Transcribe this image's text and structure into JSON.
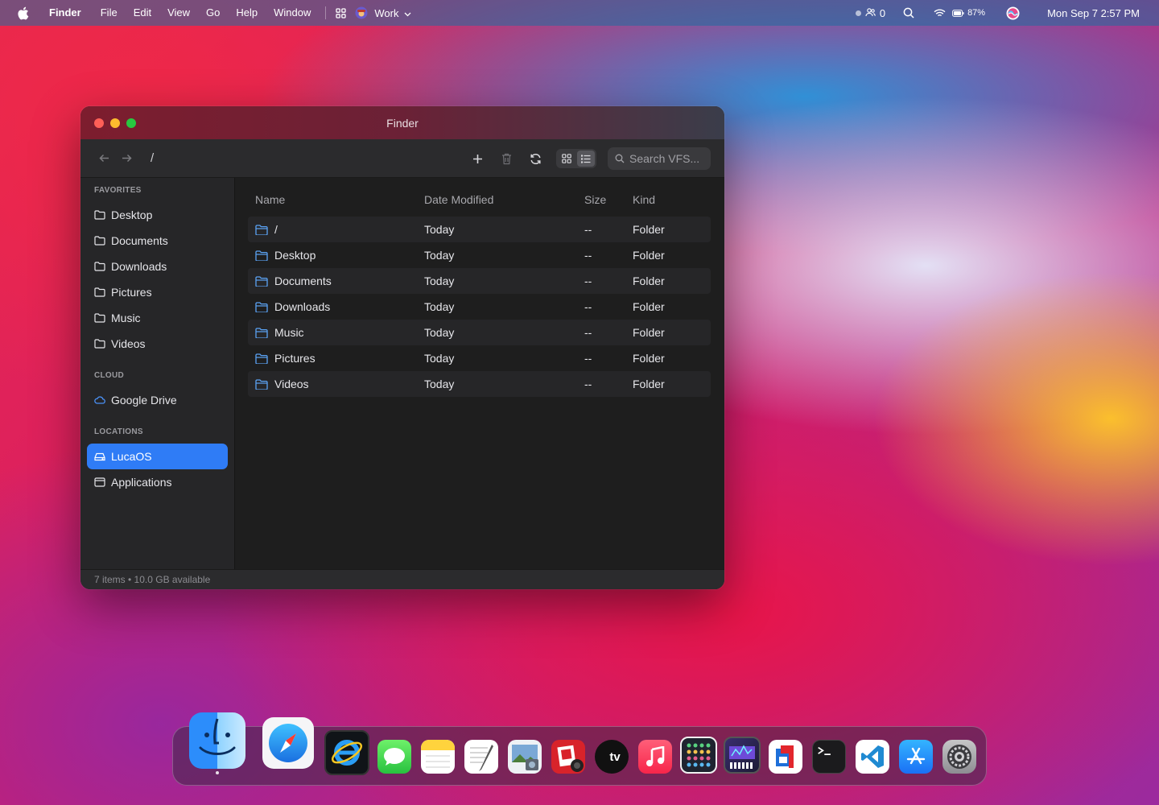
{
  "menubar": {
    "app_name": "Finder",
    "menus": [
      "File",
      "Edit",
      "View",
      "Go",
      "Help",
      "Window"
    ],
    "workspace": "Work",
    "users_count": "0",
    "battery": "87%",
    "datetime": "Mon Sep 7 2:57 PM"
  },
  "window": {
    "title": "Finder",
    "path": "/",
    "search_placeholder": "Search VFS...",
    "view_mode": "list",
    "sidebar": {
      "favorites_label": "FAVORITES",
      "favorites": [
        "Desktop",
        "Documents",
        "Downloads",
        "Pictures",
        "Music",
        "Videos"
      ],
      "cloud_label": "CLOUD",
      "cloud": [
        "Google Drive"
      ],
      "locations_label": "LOCATIONS",
      "locations": [
        "LucaOS",
        "Applications"
      ],
      "selected": "LucaOS"
    },
    "columns": {
      "name": "Name",
      "date": "Date Modified",
      "size": "Size",
      "kind": "Kind"
    },
    "rows": [
      {
        "name": "/",
        "date": "Today",
        "size": "--",
        "kind": "Folder"
      },
      {
        "name": "Desktop",
        "date": "Today",
        "size": "--",
        "kind": "Folder"
      },
      {
        "name": "Documents",
        "date": "Today",
        "size": "--",
        "kind": "Folder"
      },
      {
        "name": "Downloads",
        "date": "Today",
        "size": "--",
        "kind": "Folder"
      },
      {
        "name": "Music",
        "date": "Today",
        "size": "--",
        "kind": "Folder"
      },
      {
        "name": "Pictures",
        "date": "Today",
        "size": "--",
        "kind": "Folder"
      },
      {
        "name": "Videos",
        "date": "Today",
        "size": "--",
        "kind": "Folder"
      }
    ],
    "status": "7 items • 10.0 GB available"
  },
  "dock": {
    "apps": [
      "finder-icon",
      "safari-icon",
      "internet-explorer-icon",
      "messages-icon",
      "notes-icon",
      "textedit-icon",
      "preview-icon",
      "photo-booth-icon",
      "apple-tv-icon",
      "music-icon",
      "launchpad-grid-icon",
      "synth-icon",
      "parallels-icon",
      "terminal-icon",
      "vscode-icon",
      "app-store-icon",
      "system-settings-icon"
    ],
    "tv_label": "tv"
  },
  "colors": {
    "accent": "#2f7cf6",
    "folder": "#5ba3f5"
  }
}
